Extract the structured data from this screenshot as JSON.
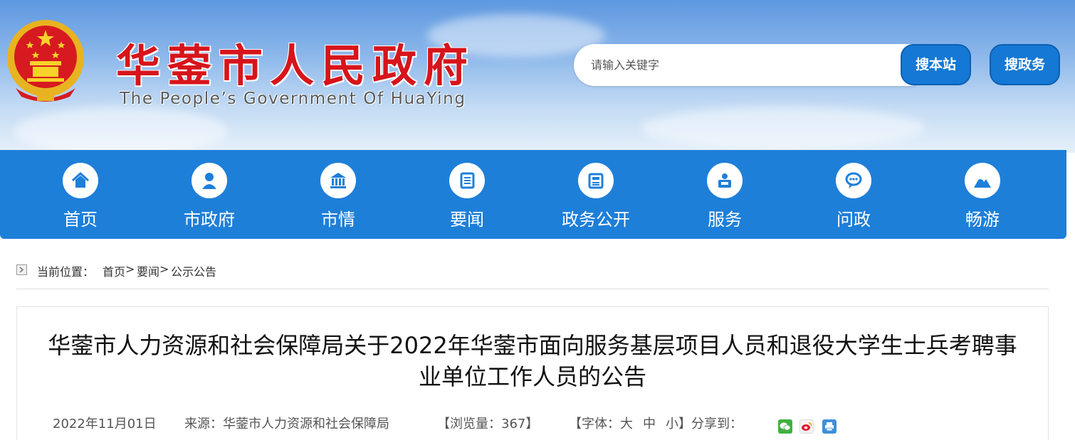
{
  "header": {
    "title": "华蓥市人民政府",
    "subtitle": "The People’s Government Of HuaYing"
  },
  "search": {
    "placeholder": "请输入关键字",
    "btn_site": "搜本站",
    "btn_gov": "搜政务"
  },
  "nav": {
    "items": [
      {
        "label": "首页",
        "icon": "home-icon"
      },
      {
        "label": "市政府",
        "icon": "person-icon"
      },
      {
        "label": "市情",
        "icon": "building-icon"
      },
      {
        "label": "要闻",
        "icon": "news-icon"
      },
      {
        "label": "政务公开",
        "icon": "document-icon"
      },
      {
        "label": "服务",
        "icon": "service-icon"
      },
      {
        "label": "问政",
        "icon": "chat-icon"
      },
      {
        "label": "畅游",
        "icon": "mountain-icon"
      }
    ]
  },
  "breadcrumb": {
    "label": "当前位置：",
    "items": [
      "首页",
      "要闻",
      "公示公告"
    ],
    "separator": ">"
  },
  "article": {
    "title": "华蓥市人力资源和社会保障局关于2022年华蓥市面向服务基层项目人员和退役大学生士兵考聘事业单位工作人员的公告",
    "date": "2022年11月01日",
    "source_label": "来源：",
    "source": "华蓥市人力资源和社会保障局",
    "views_prefix": "【浏览量：",
    "views": "367",
    "views_suffix": "】",
    "font_label": "【字体：",
    "font_large": "大",
    "font_medium": "中",
    "font_small": "小",
    "font_suffix": "】",
    "share_label": "分享到："
  },
  "colors": {
    "brand_red": "#d7141b",
    "nav_blue": "#1e7fd9",
    "button_blue": "#1478d4"
  }
}
